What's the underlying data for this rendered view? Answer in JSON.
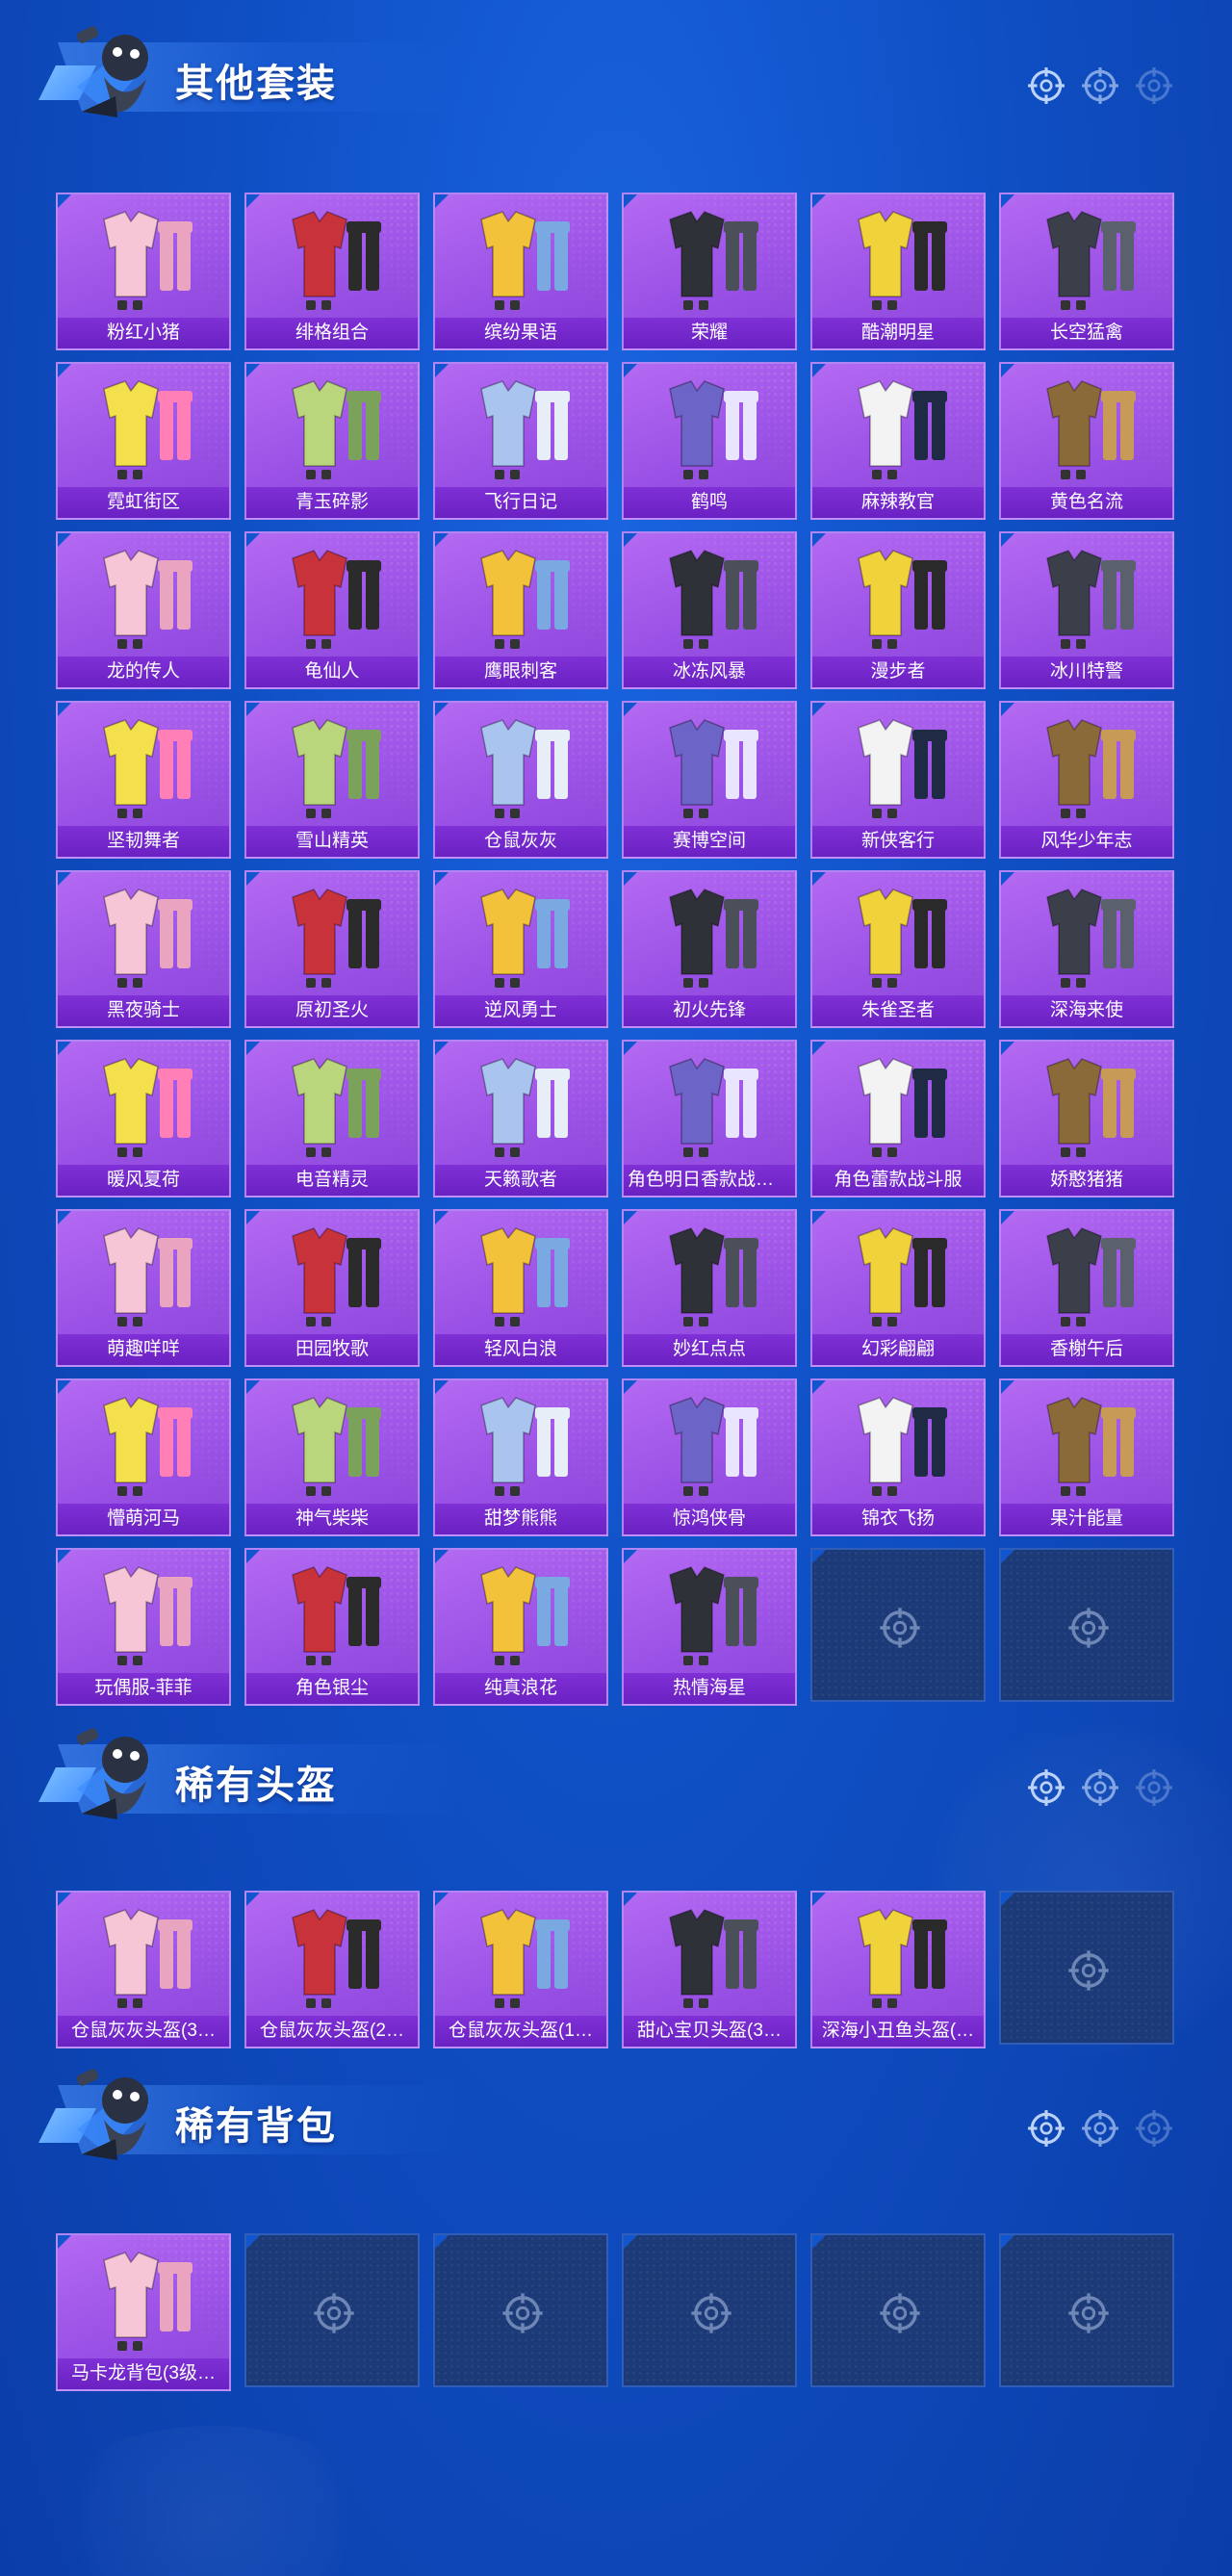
{
  "colors": {
    "background": "#1256cf",
    "card": "#a35ce9",
    "card_label": "#7028c8",
    "empty_slot": "#1d3a78"
  },
  "sections": [
    {
      "title": "其他套装",
      "icon": "mascot-icon",
      "items": [
        {
          "label": "粉红小猪",
          "icon": "pink-pig-outfit-icon"
        },
        {
          "label": "绯格组合",
          "icon": "red-plaid-outfit-icon"
        },
        {
          "label": "缤纷果语",
          "icon": "fruit-outfit-icon"
        },
        {
          "label": "荣耀",
          "icon": "dark-jacket-outfit-icon"
        },
        {
          "label": "酷潮明星",
          "icon": "yellow-coat-outfit-icon"
        },
        {
          "label": "长空猛禽",
          "icon": "camo-jacket-outfit-icon"
        },
        {
          "label": "霓虹街区",
          "icon": "neon-outfit-icon"
        },
        {
          "label": "青玉碎影",
          "icon": "green-outfit-icon"
        },
        {
          "label": "飞行日记",
          "icon": "flight-outfit-icon"
        },
        {
          "label": "鹤鸣",
          "icon": "crane-hoodie-icon"
        },
        {
          "label": "麻辣教官",
          "icon": "instructor-outfit-icon"
        },
        {
          "label": "黄色名流",
          "icon": "brown-suit-icon"
        },
        {
          "label": "龙的传人",
          "icon": "red-dragon-outfit-icon"
        },
        {
          "label": "龟仙人",
          "icon": "hawaiian-shirt-icon"
        },
        {
          "label": "鹰眼刺客",
          "icon": "assassin-outfit-icon"
        },
        {
          "label": "冰冻风暴",
          "icon": "storm-outfit-icon"
        },
        {
          "label": "漫步者",
          "icon": "walker-outfit-icon"
        },
        {
          "label": "冰川特警",
          "icon": "white-police-outfit-icon"
        },
        {
          "label": "坚韧舞者",
          "icon": "white-dancer-outfit-icon"
        },
        {
          "label": "雪山精英",
          "icon": "green-soldier-icon"
        },
        {
          "label": "仓鼠灰灰",
          "icon": "hamster-suit-icon"
        },
        {
          "label": "赛博空间",
          "icon": "cyber-outfit-icon"
        },
        {
          "label": "新侠客行",
          "icon": "black-robe-icon"
        },
        {
          "label": "风华少年志",
          "icon": "school-uniform-icon"
        },
        {
          "label": "黑夜骑士",
          "icon": "night-knight-icon"
        },
        {
          "label": "原初圣火",
          "icon": "flame-armor-icon"
        },
        {
          "label": "逆风勇士",
          "icon": "armor-warrior-icon"
        },
        {
          "label": "初火先锋",
          "icon": "vanguard-armor-icon"
        },
        {
          "label": "朱雀圣者",
          "icon": "red-armor-icon"
        },
        {
          "label": "深海来使",
          "icon": "deep-sea-armor-icon"
        },
        {
          "label": "暖风夏荷",
          "icon": "white-lotus-outfit-icon"
        },
        {
          "label": "电音精灵",
          "icon": "electro-outfit-icon"
        },
        {
          "label": "天籁歌者",
          "icon": "singer-outfit-icon"
        },
        {
          "label": "角色明日香款战斗…",
          "icon": "asuka-suit-icon"
        },
        {
          "label": "角色蕾款战斗服",
          "icon": "rei-suit-icon"
        },
        {
          "label": "娇憨猪猪",
          "icon": "pig-pajama-icon"
        },
        {
          "label": "萌趣咩咩",
          "icon": "sheep-outfit-icon"
        },
        {
          "label": "田园牧歌",
          "icon": "pastoral-outfit-icon"
        },
        {
          "label": "轻风白浪",
          "icon": "sailor-outfit-icon"
        },
        {
          "label": "妙红点点",
          "icon": "red-dots-outfit-icon"
        },
        {
          "label": "幻彩翩翩",
          "icon": "colorful-outfit-icon"
        },
        {
          "label": "香榭午后",
          "icon": "afternoon-outfit-icon"
        },
        {
          "label": "懵萌河马",
          "icon": "hippo-outfit-icon"
        },
        {
          "label": "神气柴柴",
          "icon": "shiba-outfit-icon"
        },
        {
          "label": "甜梦熊熊",
          "icon": "bear-outfit-icon"
        },
        {
          "label": "惊鸿侠骨",
          "icon": "wuxia-robe-icon"
        },
        {
          "label": "锦衣飞扬",
          "icon": "brocade-robe-icon"
        },
        {
          "label": "果汁能量",
          "icon": "juice-hoodie-icon"
        },
        {
          "label": "玩偶服-菲菲",
          "icon": "doll-suit-icon"
        },
        {
          "label": "角色银尘",
          "icon": "silver-dust-icon"
        },
        {
          "label": "纯真浪花",
          "icon": "wave-outfit-icon"
        },
        {
          "label": "热情海星",
          "icon": "starfish-outfit-icon"
        }
      ],
      "empty_slots": 2
    },
    {
      "title": "稀有头盔",
      "icon": "mascot-icon",
      "items": [
        {
          "label": "仓鼠灰灰头盔(3…",
          "icon": "hamster-helmet-icon"
        },
        {
          "label": "仓鼠灰灰头盔(2…",
          "icon": "hamster-helmet-icon"
        },
        {
          "label": "仓鼠灰灰头盔(1…",
          "icon": "hamster-helmet-icon"
        },
        {
          "label": "甜心宝贝头盔(3…",
          "icon": "sweetheart-helmet-icon"
        },
        {
          "label": "深海小丑鱼头盔(…",
          "icon": "clownfish-helmet-icon"
        }
      ],
      "empty_slots": 1
    },
    {
      "title": "稀有背包",
      "icon": "mascot-icon",
      "items": [
        {
          "label": "马卡龙背包(3级…",
          "icon": "macaron-backpack-icon"
        }
      ],
      "empty_slots": 5
    }
  ]
}
